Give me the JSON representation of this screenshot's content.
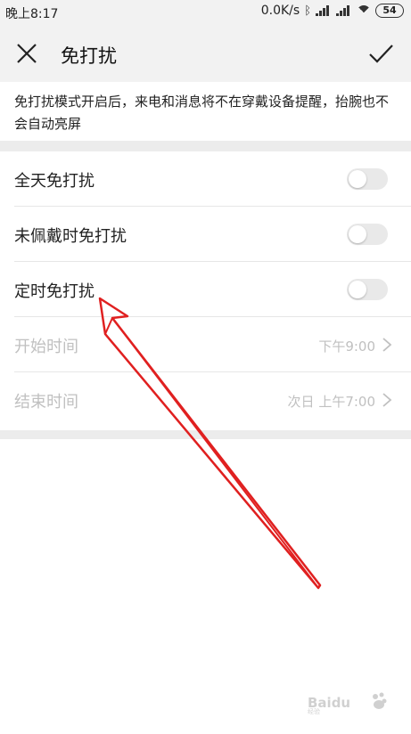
{
  "status_bar": {
    "time": "晚上8:17",
    "net_speed": "0.0K/s",
    "battery": "54"
  },
  "header": {
    "title": "免打扰",
    "close_icon": "close-icon",
    "confirm_icon": "checkmark-icon"
  },
  "description": "免打扰模式开启后，来电和消息将不在穿戴设备提醒，抬腕也不会自动亮屏",
  "settings": {
    "all_day": {
      "label": "全天免打扰",
      "on": false
    },
    "not_wearing": {
      "label": "未佩戴时免打扰",
      "on": false
    },
    "scheduled": {
      "label": "定时免打扰",
      "on": false
    },
    "start_time": {
      "label": "开始时间",
      "value": "下午9:00"
    },
    "end_time": {
      "label": "结束时间",
      "value": "次日 上午7:00"
    }
  },
  "colors": {
    "header_bg": "#f2f2f2",
    "separator": "#ececec",
    "disabled_text": "#c0c0c0",
    "toggle_off": "#e9e9e9",
    "annotation_arrow": "#e02020"
  },
  "watermark": "Baidu 经验"
}
